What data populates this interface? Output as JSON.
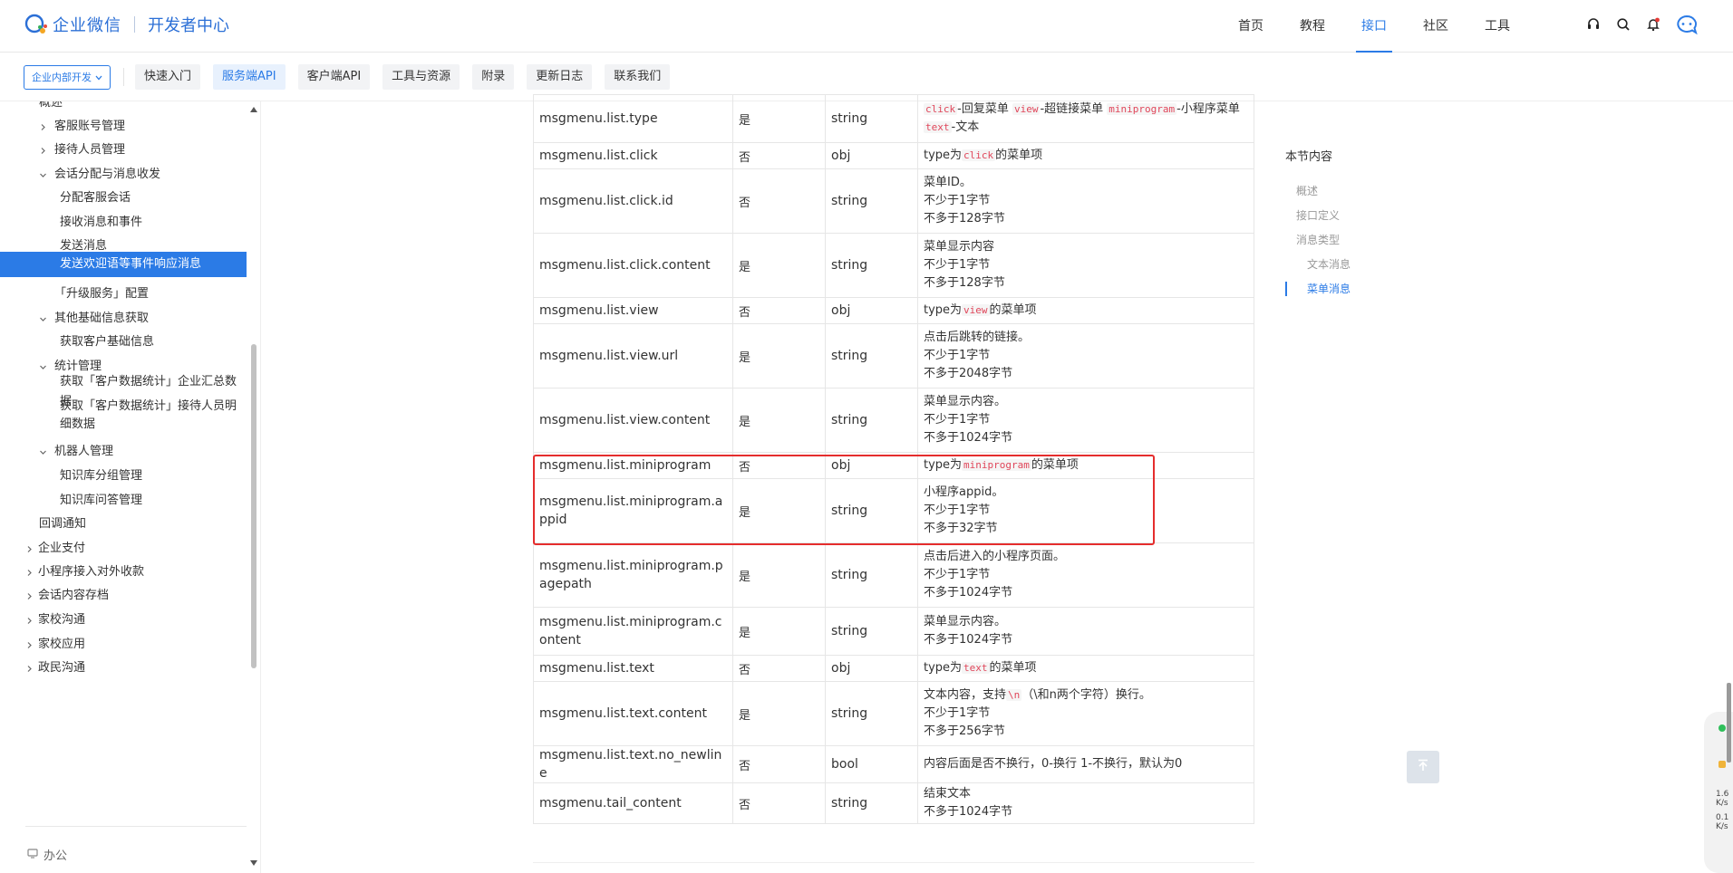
{
  "header": {
    "brand": "企业微信",
    "product": "开发者中心",
    "nav": [
      {
        "label": "首页",
        "active": false
      },
      {
        "label": "教程",
        "active": false
      },
      {
        "label": "接口",
        "active": true
      },
      {
        "label": "社区",
        "active": false
      },
      {
        "label": "工具",
        "active": false
      }
    ],
    "icons": [
      "headset-icon",
      "search-icon",
      "bell-icon",
      "chat-bubble-icon"
    ]
  },
  "subnav": {
    "scope": "企业内部开发",
    "tabs": [
      "快速入门",
      "服务端API",
      "客户端API",
      "工具与资源",
      "附录",
      "更新日志",
      "联系我们"
    ],
    "active_tab": "服务端API"
  },
  "sidebar": {
    "items": [
      {
        "label": "概述",
        "indent": 1,
        "chev": ""
      },
      {
        "label": "客服账号管理",
        "indent": 2,
        "chev": "right"
      },
      {
        "label": "接待人员管理",
        "indent": 2,
        "chev": "right"
      },
      {
        "label": "会话分配与消息收发",
        "indent": 2,
        "chev": "down"
      },
      {
        "label": "分配客服会话",
        "indent": 3,
        "chev": ""
      },
      {
        "label": "接收消息和事件",
        "indent": 3,
        "chev": ""
      },
      {
        "label": "发送消息",
        "indent": 3,
        "chev": ""
      },
      {
        "label": "发送欢迎语等事件响应消息",
        "indent": 3,
        "chev": "",
        "active": true
      },
      {
        "label": "「升级服务」配置",
        "indent": 2,
        "chev": ""
      },
      {
        "label": "其他基础信息获取",
        "indent": 2,
        "chev": "down"
      },
      {
        "label": "获取客户基础信息",
        "indent": 3,
        "chev": ""
      },
      {
        "label": "统计管理",
        "indent": 2,
        "chev": "down"
      },
      {
        "label": "获取「客户数据统计」企业汇总数据",
        "indent": 3,
        "chev": ""
      },
      {
        "label": "获取「客户数据统计」接待人员明细数据",
        "indent": 3,
        "chev": ""
      },
      {
        "label": "机器人管理",
        "indent": 2,
        "chev": "down"
      },
      {
        "label": "知识库分组管理",
        "indent": 3,
        "chev": ""
      },
      {
        "label": "知识库问答管理",
        "indent": 3,
        "chev": ""
      },
      {
        "label": "回调通知",
        "indent": 1,
        "chev": ""
      },
      {
        "label": "企业支付",
        "indent": 0,
        "chev": "right"
      },
      {
        "label": "小程序接入对外收款",
        "indent": 0,
        "chev": "right"
      },
      {
        "label": "会话内容存档",
        "indent": 0,
        "chev": "right"
      },
      {
        "label": "家校沟通",
        "indent": 0,
        "chev": "right"
      },
      {
        "label": "家校应用",
        "indent": 0,
        "chev": "right"
      },
      {
        "label": "政民沟通",
        "indent": 0,
        "chev": "right"
      }
    ],
    "footer": "办公"
  },
  "table": {
    "rows": [
      {
        "name": "msgmenu.list.type",
        "required": "是",
        "type": "string",
        "desc": [
          [
            {
              "c": "click"
            },
            {
              "t": "-回复菜单 "
            },
            {
              "c": "view"
            },
            {
              "t": "-超链接菜单 "
            },
            {
              "c": "miniprogram"
            },
            {
              "t": "-小程序菜单 "
            },
            {
              "c": "text"
            },
            {
              "t": "-文本"
            }
          ]
        ]
      },
      {
        "name": "msgmenu.list.click",
        "required": "否",
        "type": "obj",
        "desc": [
          [
            {
              "t": "type为"
            },
            {
              "c": "click"
            },
            {
              "t": "的菜单项"
            }
          ]
        ]
      },
      {
        "name": "msgmenu.list.click.id",
        "required": "否",
        "type": "string",
        "desc": [
          [
            {
              "t": "菜单ID。"
            }
          ],
          [
            {
              "t": "不少于1字节"
            }
          ],
          [
            {
              "t": "不多于128字节"
            }
          ]
        ]
      },
      {
        "name": "msgmenu.list.click.content",
        "required": "是",
        "type": "string",
        "desc": [
          [
            {
              "t": "菜单显示内容"
            }
          ],
          [
            {
              "t": "不少于1字节"
            }
          ],
          [
            {
              "t": "不多于128字节"
            }
          ]
        ]
      },
      {
        "name": "msgmenu.list.view",
        "required": "否",
        "type": "obj",
        "desc": [
          [
            {
              "t": "type为"
            },
            {
              "c": "view"
            },
            {
              "t": "的菜单项"
            }
          ]
        ]
      },
      {
        "name": "msgmenu.list.view.url",
        "required": "是",
        "type": "string",
        "desc": [
          [
            {
              "t": "点击后跳转的链接。"
            }
          ],
          [
            {
              "t": "不少于1字节"
            }
          ],
          [
            {
              "t": "不多于2048字节"
            }
          ]
        ]
      },
      {
        "name": "msgmenu.list.view.content",
        "required": "是",
        "type": "string",
        "desc": [
          [
            {
              "t": "菜单显示内容。"
            }
          ],
          [
            {
              "t": "不少于1字节"
            }
          ],
          [
            {
              "t": "不多于1024字节"
            }
          ]
        ]
      },
      {
        "name": "msgmenu.list.miniprogram",
        "required": "否",
        "type": "obj",
        "desc": [
          [
            {
              "t": "type为"
            },
            {
              "c": "miniprogram"
            },
            {
              "t": "的菜单项"
            }
          ]
        ]
      },
      {
        "name": "msgmenu.list.miniprogram.appid",
        "required": "是",
        "type": "string",
        "desc": [
          [
            {
              "t": "小程序appid。"
            }
          ],
          [
            {
              "t": "不少于1字节"
            }
          ],
          [
            {
              "t": "不多于32字节"
            }
          ]
        ]
      },
      {
        "name": "msgmenu.list.miniprogram.pagepath",
        "required": "是",
        "type": "string",
        "desc": [
          [
            {
              "t": "点击后进入的小程序页面。"
            }
          ],
          [
            {
              "t": "不少于1字节"
            }
          ],
          [
            {
              "t": "不多于1024字节"
            }
          ]
        ]
      },
      {
        "name": "msgmenu.list.miniprogram.content",
        "required": "是",
        "type": "string",
        "desc": [
          [
            {
              "t": "菜单显示内容。"
            }
          ],
          [
            {
              "t": "不多于1024字节"
            }
          ]
        ]
      },
      {
        "name": "msgmenu.list.text",
        "required": "否",
        "type": "obj",
        "desc": [
          [
            {
              "t": "type为"
            },
            {
              "c": "text"
            },
            {
              "t": "的菜单项"
            }
          ]
        ]
      },
      {
        "name": "msgmenu.list.text.content",
        "required": "是",
        "type": "string",
        "desc": [
          [
            {
              "t": "文本内容，支持"
            },
            {
              "c": "\\n"
            },
            {
              "t": "（\\和n两个字符）换行。"
            }
          ],
          [
            {
              "t": "不少于1字节"
            }
          ],
          [
            {
              "t": "不多于256字节"
            }
          ]
        ]
      },
      {
        "name": "msgmenu.list.text.no_newline",
        "required": "否",
        "type": "bool",
        "desc": [
          [
            {
              "t": "内容后面是否不换行，0-换行 1-不换行，默认为0"
            }
          ]
        ]
      },
      {
        "name": "msgmenu.tail_content",
        "required": "否",
        "type": "string",
        "desc": [
          [
            {
              "t": "结束文本"
            }
          ],
          [
            {
              "t": "不多于1024字节"
            }
          ]
        ]
      }
    ]
  },
  "toc": {
    "title": "本节内容",
    "items": [
      {
        "label": "概述",
        "level": 1,
        "active": false
      },
      {
        "label": "接口定义",
        "level": 1,
        "active": false
      },
      {
        "label": "消息类型",
        "level": 1,
        "active": false
      },
      {
        "label": "文本消息",
        "level": 2,
        "active": false
      },
      {
        "label": "菜单消息",
        "level": 2,
        "active": true
      }
    ]
  },
  "rail": {
    "values": [
      "1.6",
      "K/s",
      "0.1",
      "K/s"
    ]
  },
  "colors": {
    "accent": "#2b7be6",
    "highlight_border": "#e52d2d",
    "code": "#e0475b"
  }
}
